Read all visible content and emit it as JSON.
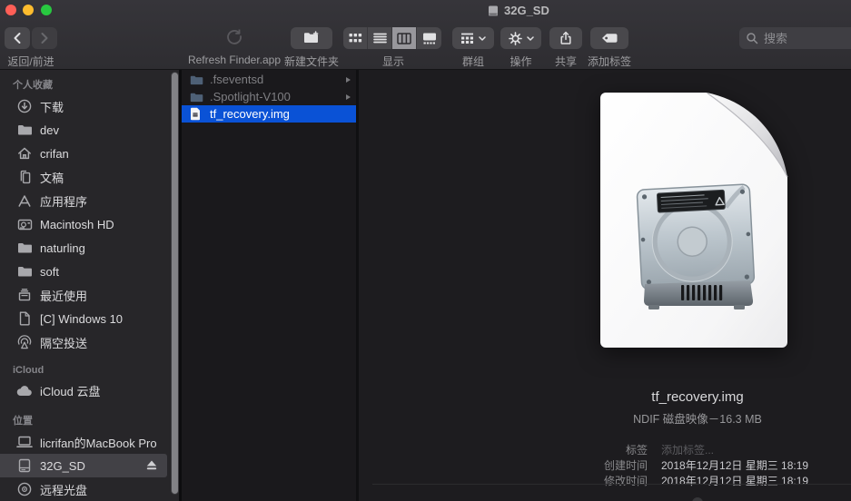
{
  "window": {
    "title": "32G_SD"
  },
  "toolbar": {
    "back_forward_label": "返回/前进",
    "refresh_app_label": "Refresh Finder.app",
    "new_folder_label": "新建文件夹",
    "view_label": "显示",
    "group_label": "群组",
    "action_label": "操作",
    "share_label": "共享",
    "tags_label": "添加标签",
    "search_placeholder": "搜索"
  },
  "sidebar": {
    "sections": [
      {
        "title": "个人收藏",
        "items": [
          {
            "label": "下载",
            "icon": "download-icon"
          },
          {
            "label": "dev",
            "icon": "folder-icon"
          },
          {
            "label": "crifan",
            "icon": "home-icon"
          },
          {
            "label": "文稿",
            "icon": "documents-icon"
          },
          {
            "label": "应用程序",
            "icon": "applications-icon"
          },
          {
            "label": "Macintosh HD",
            "icon": "harddrive-icon"
          },
          {
            "label": "naturling",
            "icon": "folder-icon"
          },
          {
            "label": "soft",
            "icon": "folder-icon"
          },
          {
            "label": "最近使用",
            "icon": "recents-icon"
          },
          {
            "label": "[C] Windows 10",
            "icon": "document-icon"
          },
          {
            "label": "隔空投送",
            "icon": "airdrop-icon"
          }
        ]
      },
      {
        "title": "iCloud",
        "items": [
          {
            "label": "iCloud 云盘",
            "icon": "cloud-icon"
          }
        ]
      },
      {
        "title": "位置",
        "items": [
          {
            "label": "licrifan的MacBook Pro",
            "icon": "laptop-icon"
          },
          {
            "label": "32G_SD",
            "icon": "external-disk-icon",
            "selected": true,
            "ejectable": true
          },
          {
            "label": "远程光盘",
            "icon": "disc-icon"
          }
        ]
      }
    ]
  },
  "file_list": {
    "items": [
      {
        "name": ".fseventsd",
        "type": "folder",
        "hidden": true,
        "has_children": true
      },
      {
        "name": ".Spotlight-V100",
        "type": "folder",
        "hidden": true,
        "has_children": true
      },
      {
        "name": "tf_recovery.img",
        "type": "disk-image-file",
        "selected": true
      }
    ]
  },
  "preview": {
    "file_name": "tf_recovery.img",
    "file_kind": "NDIF 磁盘映像－16.3 MB",
    "info": [
      {
        "label": "标签",
        "value": "添加标签...",
        "muted": true
      },
      {
        "label": "创建时间",
        "value": "2018年12月12日 星期三 18:19"
      },
      {
        "label": "修改时间",
        "value": "2018年12月12日 星期三 18:19"
      }
    ]
  },
  "colors": {
    "selection_blue": "#0a52d6",
    "sidebar_selected_gray": "#424146",
    "chrome_bg": "#323135",
    "sidebar_bg": "#272629",
    "content_bg": "#1a191c",
    "preview_bg": "#1d1c1f",
    "traffic_red": "#ff5f57",
    "traffic_yellow": "#febc2e",
    "traffic_green": "#28c840"
  }
}
